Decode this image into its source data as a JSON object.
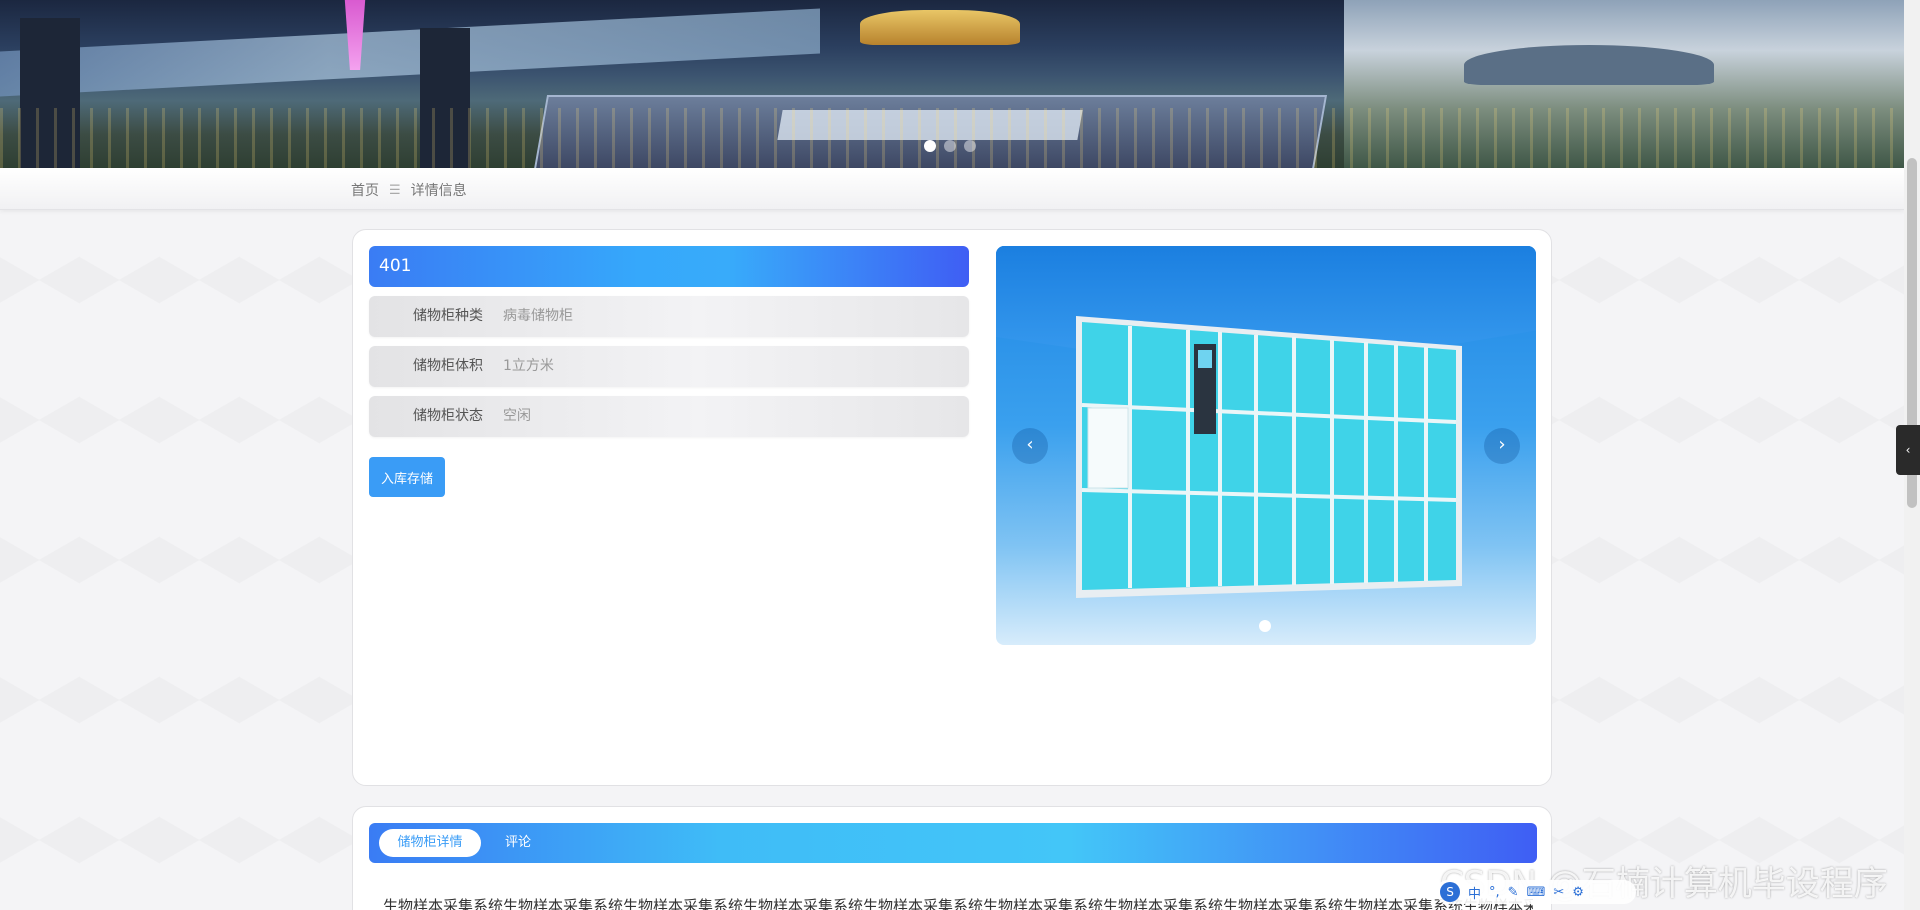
{
  "banner": {
    "slides": 3,
    "active_slide": 1
  },
  "breadcrumb": {
    "home": "首页",
    "separator": "☰",
    "current": "详情信息"
  },
  "detail": {
    "title": "401",
    "fields": [
      {
        "label": "储物柜种类",
        "value": "病毒储物柜"
      },
      {
        "label": "储物柜体积",
        "value": "1立方米"
      },
      {
        "label": "储物柜状态",
        "value": "空闲"
      }
    ],
    "store_button": "入库存储"
  },
  "carousel": {
    "prev_icon": "‹",
    "next_icon": "›",
    "slides": 1,
    "active_slide": 1
  },
  "tabs": {
    "items": [
      "储物柜详情",
      "评论"
    ],
    "active": 0,
    "description": "生物样本采集系统生物样本采集系统生物样本采集系统生物样本采集系统生物样本采集系统生物样本采集系统生物样本采集系统生物样本采集系统生物样本采集系统生物样本采集系"
  },
  "side_toggle": {
    "icon": "‹"
  },
  "ime_toolbar": {
    "logo": "S",
    "mode": "中"
  },
  "watermark": "CSDN @石楠计算机毕设程序",
  "colors": {
    "accent_blue": "#3a9cf6",
    "title_gradient_start": "#3a7cf4",
    "title_gradient_end": "#3f5ef4",
    "locker_cyan": "#3fd3e8"
  }
}
